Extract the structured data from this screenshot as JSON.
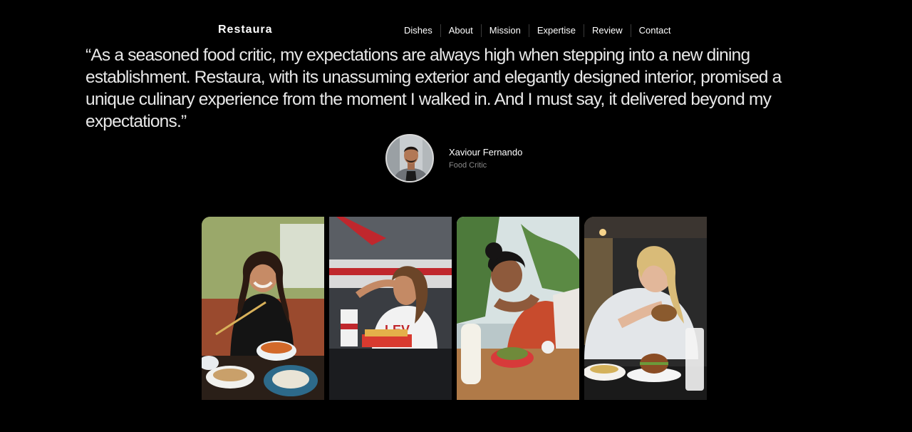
{
  "header": {
    "logo": "Restaura",
    "nav": [
      {
        "label": "Dishes"
      },
      {
        "label": "About"
      },
      {
        "label": "Mission"
      },
      {
        "label": "Expertise"
      },
      {
        "label": "Review"
      },
      {
        "label": "Contact"
      }
    ]
  },
  "review": {
    "quote": "“As a seasoned food critic, my expectations are always high when stepping into a new dining establishment. Restaura, with its unassuming exterior and elegantly designed interior, promised a unique culinary experience from the moment I walked in. And I must say, it delivered beyond my expectations.”",
    "author_name": "Xaviour Fernando",
    "author_role": "Food Critic"
  },
  "gallery": [
    {
      "icon": "photo-woman-with-chopsticks"
    },
    {
      "icon": "photo-woman-eating-fries"
    },
    {
      "icon": "photo-woman-eating-taco"
    },
    {
      "icon": "photo-woman-eating-burger"
    }
  ],
  "colors": {
    "background": "#000000",
    "text": "#ffffff",
    "muted": "#8a8a8a"
  }
}
